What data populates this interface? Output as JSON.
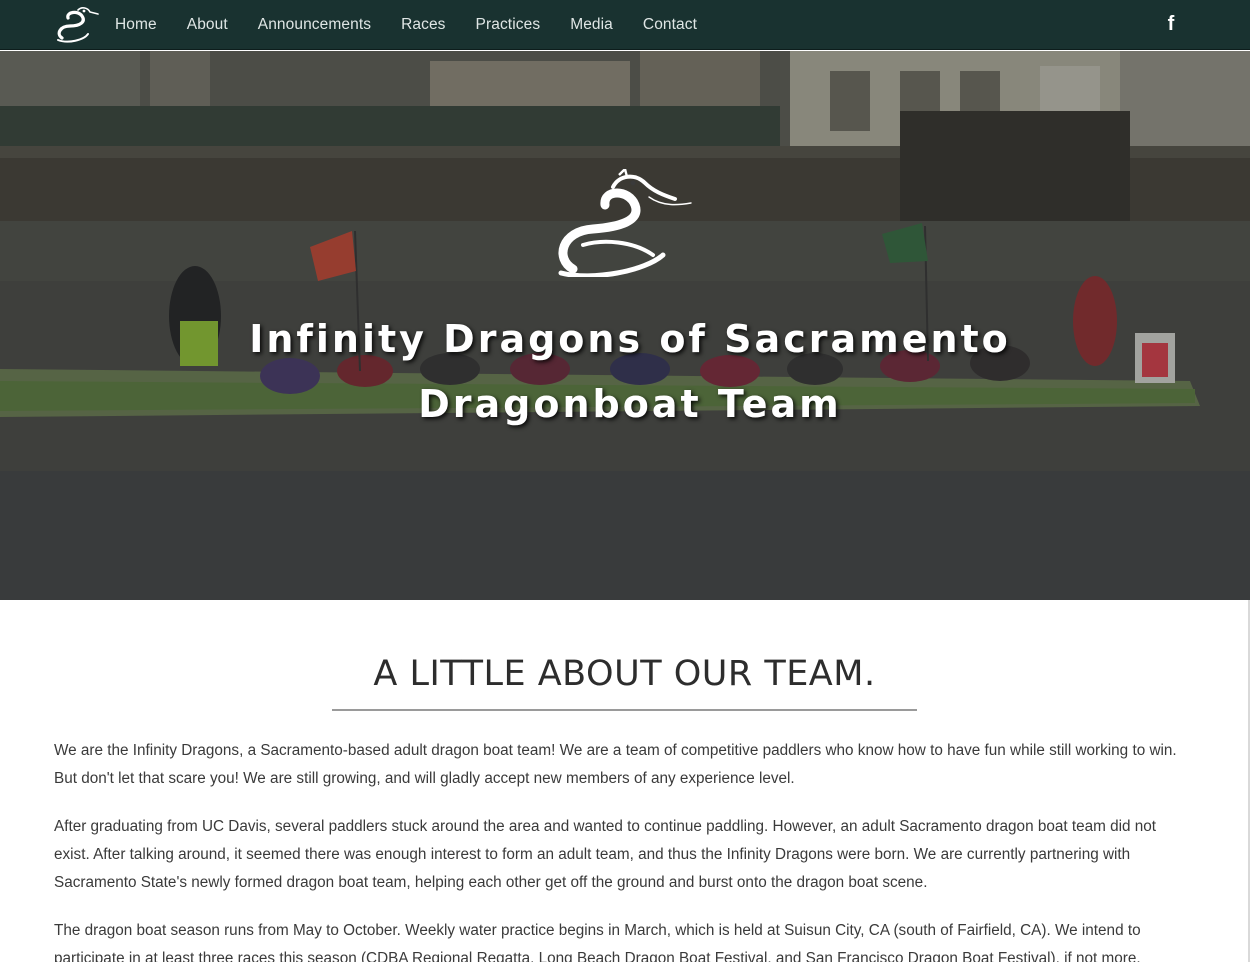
{
  "nav": {
    "logo_icon": "dragon-logo-icon",
    "items": [
      {
        "label": "Home"
      },
      {
        "label": "About"
      },
      {
        "label": "Announcements"
      },
      {
        "label": "Races"
      },
      {
        "label": "Practices"
      },
      {
        "label": "Media"
      },
      {
        "label": "Contact"
      }
    ],
    "social_icon": "facebook-icon",
    "social_glyph": "f"
  },
  "hero": {
    "logo_icon": "dragon-logo-icon",
    "title_line1": "Infinity Dragons of Sacramento",
    "title_line2": "Dragonboat Team"
  },
  "about": {
    "heading": "A LITTLE ABOUT OUR TEAM.",
    "paragraphs": [
      "We are the Infinity Dragons, a Sacramento-based adult dragon boat team! We are a team of competitive paddlers who know how to have fun while still working to win. But don't let that scare you! We are still growing, and will gladly accept new members of any experience level.",
      "After graduating from UC Davis, several paddlers stuck around the area and wanted to continue paddling. However, an adult Sacramento dragon boat team did not exist. After talking around, it seemed there was enough interest to form an adult team, and thus the Infinity Dragons were born. We are currently partnering with Sacramento State's newly formed dragon boat team, helping each other get off the ground and burst onto the dragon boat scene.",
      "The dragon boat season runs from May to October. Weekly water practice begins in March, which is held at Suisun City, CA (south of Fairfield, CA). We intend to participate in at least three races this season (CDBA Regional Regatta, Long Beach Dragon Boat Festival, and San Francisco Dragon Boat Festival), if not more."
    ]
  },
  "colors": {
    "navbar_bg": "#193230",
    "hero_overlay": "#4e504d",
    "heading_text": "#2d2d2d",
    "body_text": "#3a3a3a"
  }
}
